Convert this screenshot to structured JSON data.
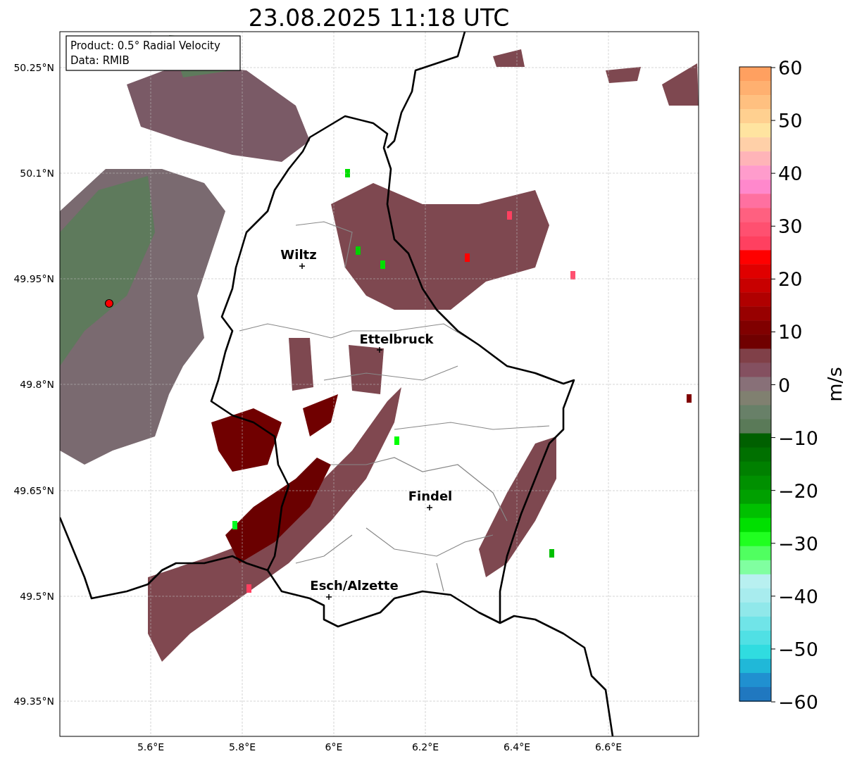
{
  "title": "23.08.2025 11:18 UTC",
  "info_box": {
    "lines": [
      "Product: 0.5° Radial Velocity",
      "Data: RMIB"
    ]
  },
  "map": {
    "places": [
      {
        "name": "Wiltz"
      },
      {
        "name": "Ettelbruck"
      },
      {
        "name": "Findel"
      },
      {
        "name": "Esch/Alzette"
      }
    ],
    "y_ticks": [
      "50.25°N",
      "50.1°N",
      "49.95°N",
      "49.8°N",
      "49.65°N",
      "49.5°N",
      "49.35°N"
    ],
    "x_ticks": [
      "5.6°E",
      "5.8°E",
      "6°E",
      "6.2°E",
      "6.4°E",
      "6.6°E"
    ]
  },
  "colorbar": {
    "label": "m/s",
    "ticks": [
      "60",
      "50",
      "40",
      "30",
      "20",
      "10",
      "0",
      "−10",
      "−20",
      "−30",
      "−40",
      "−50",
      "−60"
    ]
  }
}
